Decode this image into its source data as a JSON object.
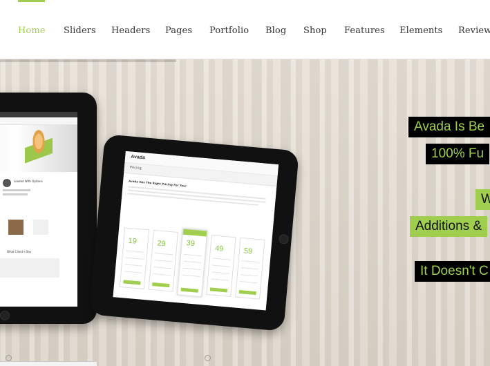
{
  "colors": {
    "accent": "#a0ce4e",
    "text": "#333333",
    "hero_bg": "#ddd6cb"
  },
  "nav": {
    "items": [
      {
        "label": "Home",
        "active": true
      },
      {
        "label": "Sliders"
      },
      {
        "label": "Headers"
      },
      {
        "label": "Pages"
      },
      {
        "label": "Portfolio"
      },
      {
        "label": "Blog"
      },
      {
        "label": "Shop"
      },
      {
        "label": "Features"
      },
      {
        "label": "Elements"
      },
      {
        "label": "Review"
      }
    ]
  },
  "slider": {
    "captions": [
      "Avada Is Be",
      "100% Fu",
      "W",
      "Additions &",
      "It Doesn't C"
    ],
    "tablet_screen": {
      "logo": "Avada",
      "page_title": "Pricing",
      "section_heading": "Avada Has The Right Pricing For You!",
      "prices": [
        "19",
        "29",
        "39",
        "49",
        "59"
      ],
      "side_heading": "What Client's Say",
      "left_headings": [
        "Loaded With Options"
      ]
    }
  }
}
